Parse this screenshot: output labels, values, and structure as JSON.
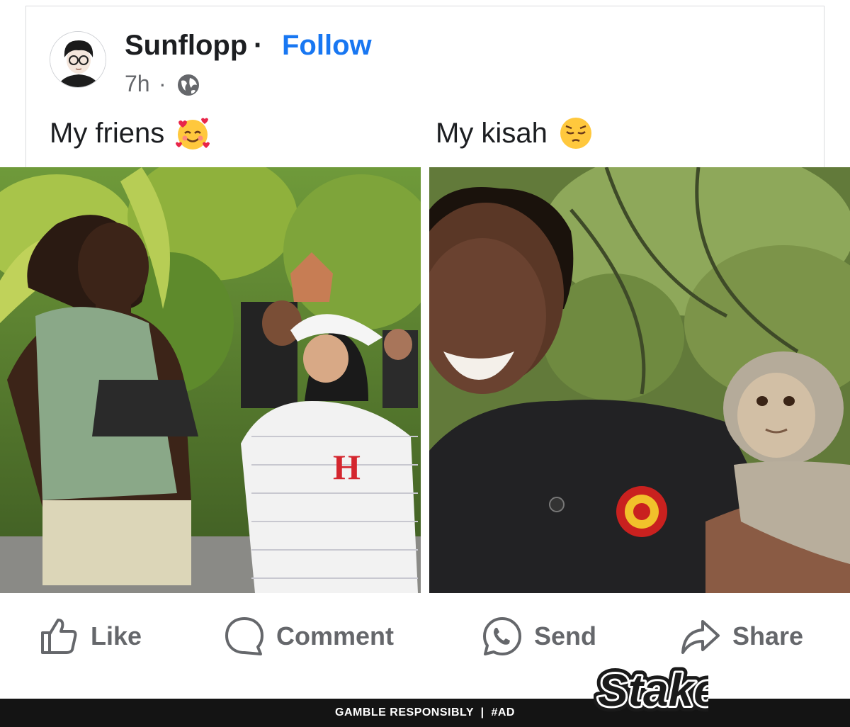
{
  "post": {
    "author": "Sunflopp",
    "separator": "·",
    "follow_label": "Follow",
    "time": "7h",
    "time_separator": "·",
    "audience_icon": "globe-icon"
  },
  "captions": {
    "left": "My friens",
    "left_emoji": "smiling-face-with-hearts-emoji",
    "right": "My kisah",
    "right_emoji": "pensive-face-emoji"
  },
  "actions": [
    {
      "label": "Like",
      "icon": "thumbs-up-icon"
    },
    {
      "label": "Comment",
      "icon": "comment-bubble-icon"
    },
    {
      "label": "Send",
      "icon": "whatsapp-icon"
    },
    {
      "label": "Share",
      "icon": "share-arrow-icon"
    }
  ],
  "ad": {
    "disclaimer": "GAMBLE RESPONSIBLY  |  #AD",
    "brand": "Stake"
  },
  "colors": {
    "link": "#1877f2",
    "muted": "#65676b",
    "ad_bar": "#141414"
  }
}
